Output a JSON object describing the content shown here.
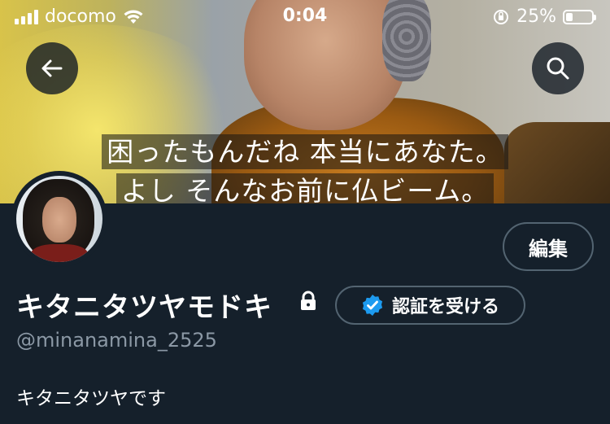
{
  "status_bar": {
    "carrier": "docomo",
    "time": "0:04",
    "battery_percent": "25%",
    "battery_level": 0.25
  },
  "header": {
    "caption_line1": "困ったもんだね 本当にあなた。",
    "caption_line2": "よし そんなお前に仏ビーム。",
    "back_icon": "arrow-left-icon",
    "search_icon": "search-icon"
  },
  "profile": {
    "edit_label": "編集",
    "display_name": "キタニタツヤモドキ",
    "verify_label": "認証を受ける",
    "handle": "@minanamina_2525",
    "bio": "キタニタツヤです"
  },
  "colors": {
    "background": "#15202b",
    "border": "#536471",
    "muted_text": "#8b98a5",
    "verify_blue": "#1d9bf0"
  }
}
